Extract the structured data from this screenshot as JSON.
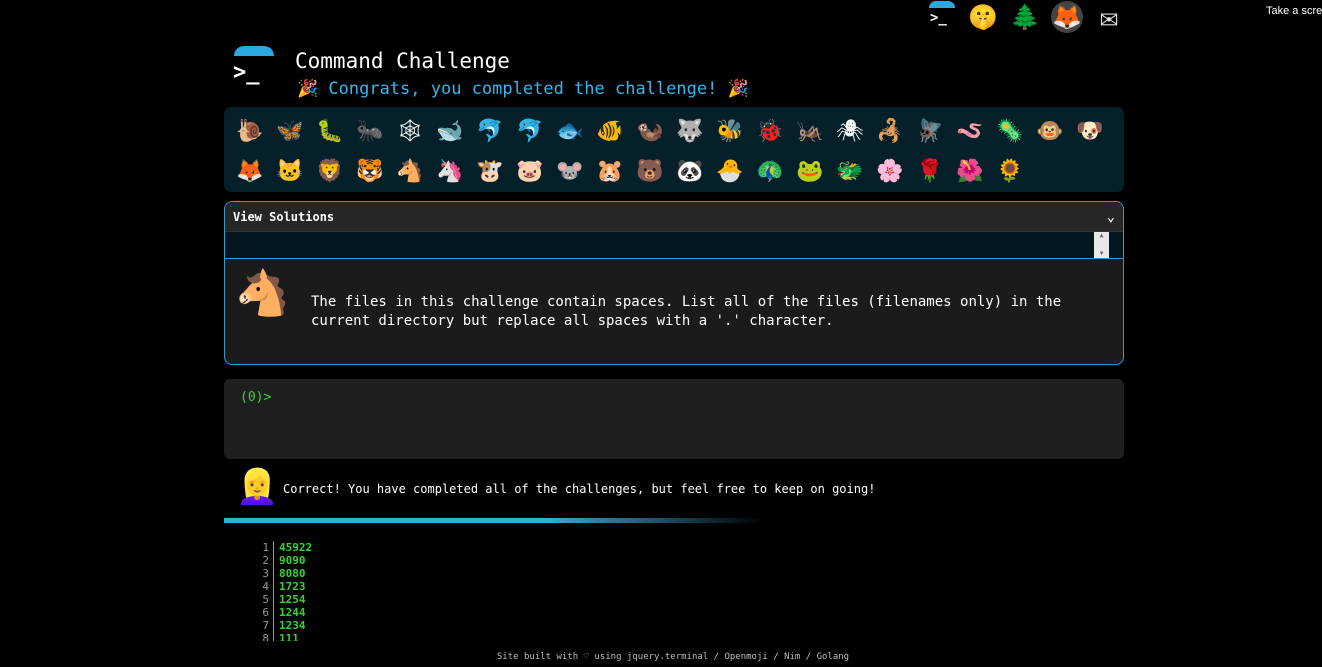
{
  "topbar": {
    "logo_prompt": ">_",
    "icons": [
      {
        "name": "shushing-face-icon",
        "glyph": "🤫"
      },
      {
        "name": "evergreen-tree-icon",
        "glyph": "🌲"
      },
      {
        "name": "gitlab-icon",
        "glyph": "🦊"
      },
      {
        "name": "mail-icon",
        "glyph": "✉"
      }
    ],
    "take_screenshot": "Take a scre"
  },
  "header": {
    "logo_prompt": ">_",
    "title": "Command Challenge",
    "subtitle": "🎉 Congrats, you completed the challenge! 🎉"
  },
  "animals": [
    "🐌",
    "🦋",
    "🐛",
    "🐜",
    "🕸",
    "🐋",
    "🐬",
    "🐬",
    "🐟",
    "🐠",
    "🦦",
    "🐺",
    "🐝",
    "🐞",
    "🦗",
    "🕷",
    "🦂",
    "🪰",
    "🪱",
    "🦠",
    "🐵",
    "🐶",
    "🦊",
    "🐱",
    "🦁",
    "🐯",
    "🐴",
    "🦄",
    "🐮",
    "🐷",
    "🐭",
    "🐹",
    "🐻",
    "🐼",
    "🐣",
    "🦚",
    "🐸",
    "🐲",
    "🌸",
    "🌹",
    "🌺",
    "🌻"
  ],
  "solutions": {
    "title": "View Solutions",
    "chevron": "⌄",
    "horse": "🐴",
    "text": "The files in this challenge contain spaces. List all of the files (filenames only) in the current directory but replace all spaces with a '.' character."
  },
  "terminal": {
    "prompt": "(0)>"
  },
  "feedback": {
    "avatar": "👱‍♀️",
    "text": "Correct! You have completed all of the challenges, but feel free to keep on going!"
  },
  "output": [
    {
      "n": "1",
      "v": "45922"
    },
    {
      "n": "2",
      "v": "9090"
    },
    {
      "n": "3",
      "v": "8080"
    },
    {
      "n": "4",
      "v": "1723"
    },
    {
      "n": "5",
      "v": "1254"
    },
    {
      "n": "6",
      "v": "1244"
    },
    {
      "n": "7",
      "v": "1234"
    },
    {
      "n": "8",
      "v": "111"
    }
  ],
  "footer": "Site built with ♡ using jquery.terminal / Openmoji / Nim / Golang",
  "colors": {
    "accent": "#38b6f0",
    "prompt_green": "#3ed13e",
    "panel": "#06202a"
  }
}
